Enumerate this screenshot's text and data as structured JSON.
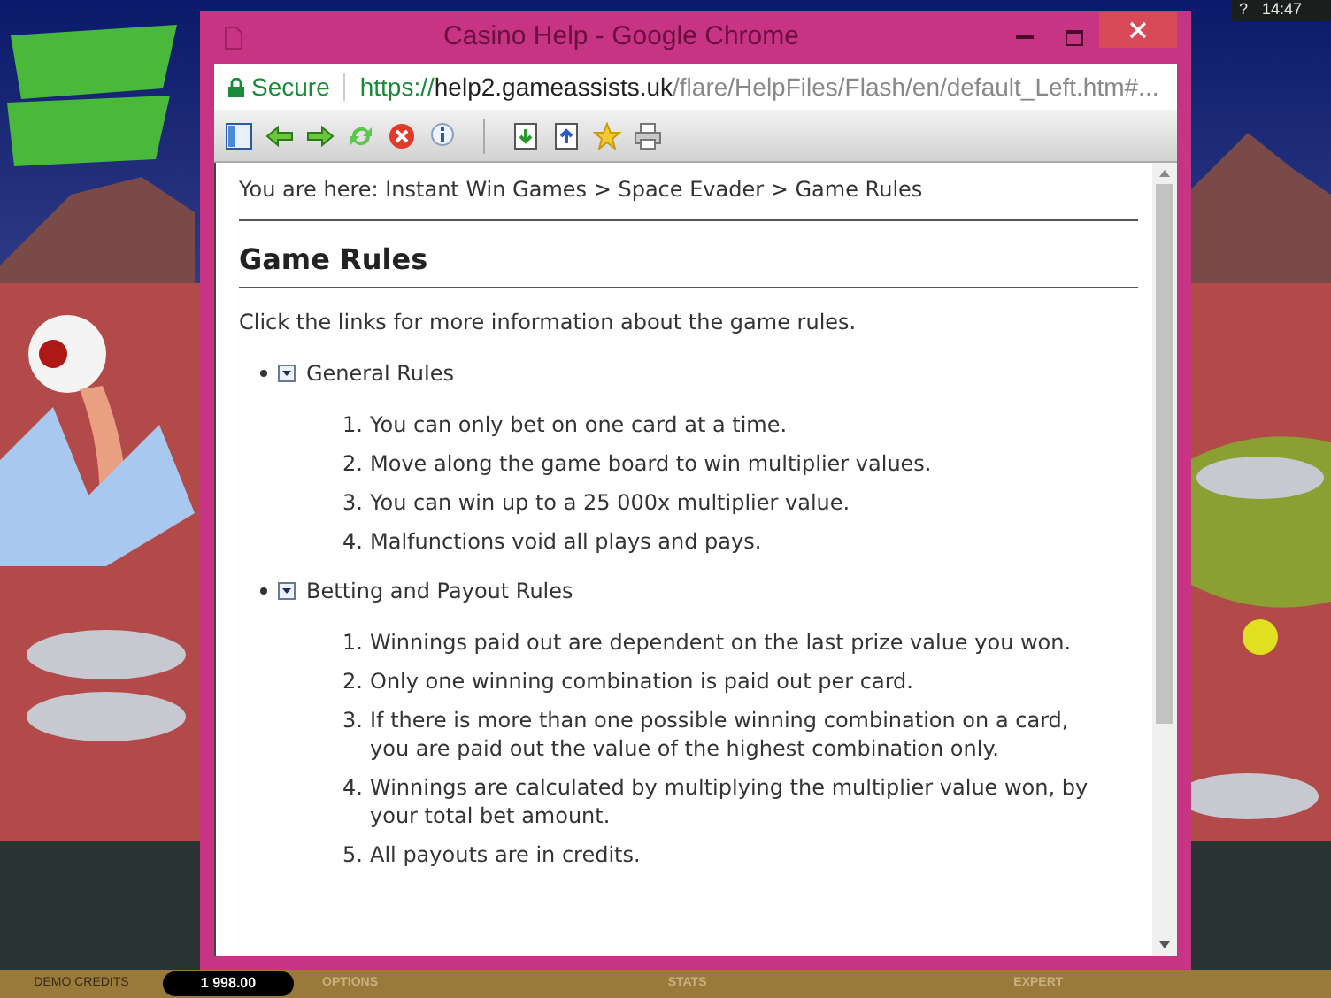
{
  "game": {
    "help_glyph": "?",
    "clock": "14:47",
    "bottom_bar": [
      {
        "kind": "label",
        "text": "DEMO CREDITS"
      },
      {
        "kind": "balance",
        "text": "1 998.00"
      },
      {
        "kind": "menu",
        "text": "OPTIONS"
      },
      {
        "kind": "menu",
        "text": "STATS"
      },
      {
        "kind": "menu",
        "text": "EXPERT"
      }
    ]
  },
  "window": {
    "title": "Casino Help - Google Chrome"
  },
  "address_bar": {
    "security": "Secure",
    "url_scheme": "https://",
    "url_host": "help2.gameassists.uk",
    "url_path": "/flare/HelpFiles/Flash/en/default_Left.htm#..."
  },
  "breadcrumb": "You are here: Instant Win Games > Space Evader > Game Rules",
  "heading": "Game Rules",
  "intro": "Click the links for more information about the game rules.",
  "sections": [
    {
      "title": "General Rules",
      "expanded": true,
      "rules": [
        {
          "number": "1.",
          "text": "You can only bet on one card at a time."
        },
        {
          "number": "2.",
          "text": "Move along the game board to win multiplier values."
        },
        {
          "number": "3.",
          "text": "You can win up to a 25 000x multiplier value."
        },
        {
          "number": "4.",
          "text": "Malfunctions void all plays and pays."
        }
      ]
    },
    {
      "title": "Betting and Payout Rules",
      "expanded": true,
      "rules": [
        {
          "number": "1.",
          "text": "Winnings paid out are dependent on the last prize value you won."
        },
        {
          "number": "2.",
          "text": "Only one winning combination is paid out per card."
        },
        {
          "number": "3.",
          "text": "If there is more than one possible winning combination on a card, you are paid out the value of the highest combination only."
        },
        {
          "number": "4.",
          "text": "Winnings are calculated by multiplying the multiplier value won, by your total bet amount."
        },
        {
          "number": "5.",
          "text": "All payouts are in credits."
        }
      ]
    }
  ]
}
